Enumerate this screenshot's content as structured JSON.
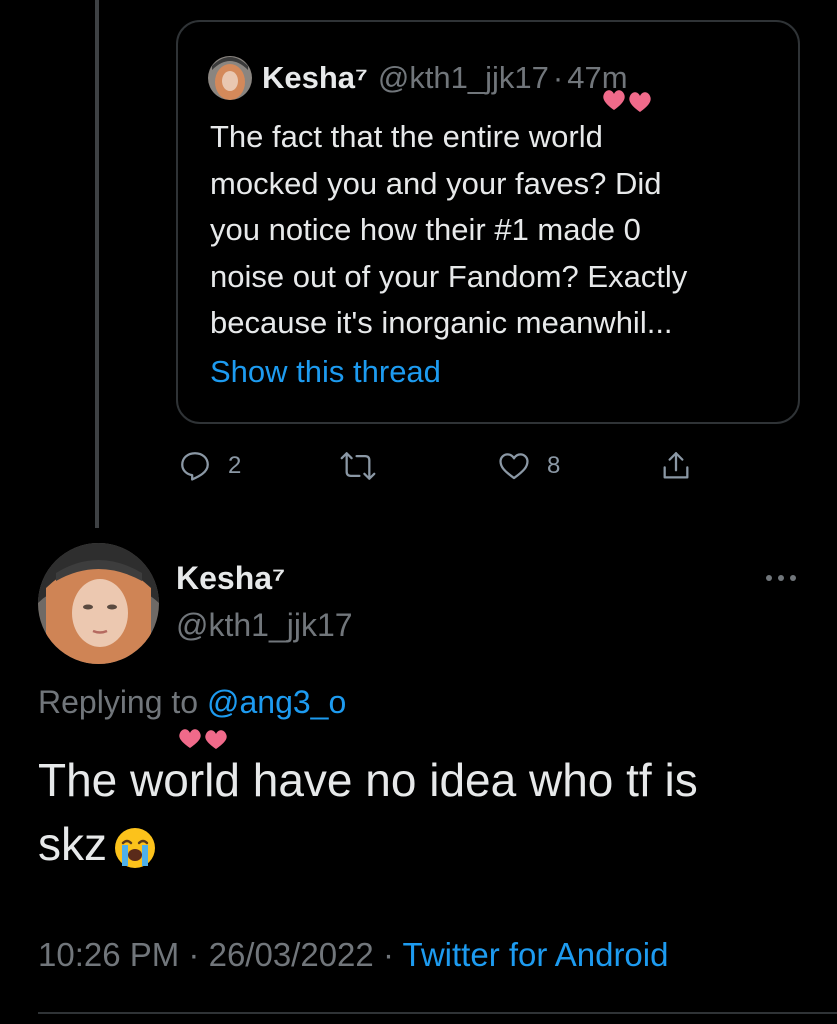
{
  "colors": {
    "background": "#000000",
    "text": "#e7e9ea",
    "muted": "#71767b",
    "link": "#1d9bf0",
    "border": "#2f3336",
    "heart_doodle": "#f06a8a"
  },
  "quoted_tweet": {
    "author_name": "Kesha⁷",
    "author_handle": "@kth1_jjk17",
    "separator": "·",
    "time": "47m",
    "text_lines": [
      "The fact that the entire world",
      "mocked you and your faves? Did",
      "you notice how their #1 made 0",
      "noise out of your Fandom? Exactly",
      "because it's inorganic meanwhil..."
    ],
    "show_thread_label": "Show this thread",
    "actions": {
      "reply_icon": "reply-bubble-icon",
      "reply_count": "2",
      "retweet_icon": "retweet-icon",
      "like_icon": "heart-outline-icon",
      "like_count": "8",
      "share_icon": "share-icon"
    }
  },
  "main_tweet": {
    "author_name": "Kesha⁷",
    "author_handle": "@kth1_jjk17",
    "more_icon": "more-horizontal-icon",
    "replying_prefix": "Replying to",
    "replying_mention": "@ang3_o",
    "text_lines": [
      "The world have no idea who tf is",
      "skz"
    ],
    "emoji": "loudly-crying-face-emoji",
    "time": "10:26 PM",
    "separator": "·",
    "date": "26/03/2022",
    "source": "Twitter for Android"
  }
}
